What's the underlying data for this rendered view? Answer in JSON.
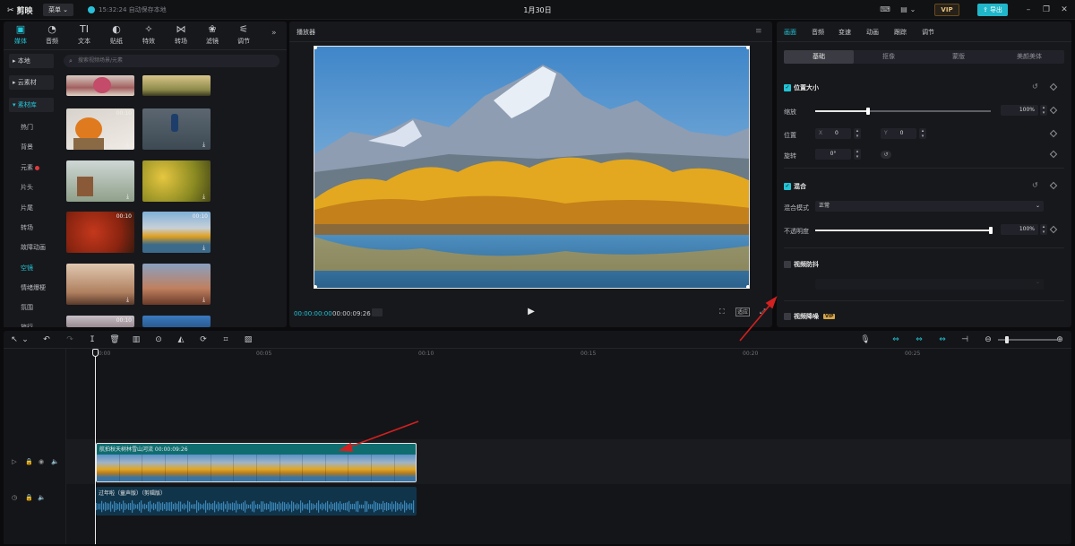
{
  "app": {
    "name": "剪映",
    "menu_label": "菜单",
    "save_status": "15:32:24 自动保存本地",
    "project_title": "1月30日",
    "vip_label": "VIP",
    "export_label": "导出"
  },
  "media_tabs": [
    {
      "label": "媒体",
      "icon": "media-icon"
    },
    {
      "label": "音频",
      "icon": "audio-icon"
    },
    {
      "label": "文本",
      "icon": "text-icon"
    },
    {
      "label": "贴纸",
      "icon": "sticker-icon"
    },
    {
      "label": "特效",
      "icon": "effects-icon"
    },
    {
      "label": "转场",
      "icon": "transition-icon"
    },
    {
      "label": "滤镜",
      "icon": "filter-icon"
    },
    {
      "label": "调节",
      "icon": "adjust-icon"
    }
  ],
  "left_categories": {
    "local": "本地",
    "cloud": "云素材",
    "library": "素材库",
    "subs": [
      "热门",
      "背景",
      "元素",
      "片头",
      "片尾",
      "转场",
      "故障动画",
      "空镜",
      "情绪爆梗",
      "氛围",
      "旅行"
    ]
  },
  "search_placeholder": "搜索视频场景/元素",
  "thumb_durations": [
    "00:10",
    "00:10",
    "00:10",
    "00:10"
  ],
  "player": {
    "title": "播放器",
    "time_current": "00:00:00:00",
    "time_total": "00:00:09:26",
    "ratio_label": "适应"
  },
  "right_tabs": [
    "画面",
    "音频",
    "变速",
    "动画",
    "跟踪",
    "调节"
  ],
  "right_subtabs": [
    "基础",
    "抠像",
    "蒙版",
    "美颜美体"
  ],
  "props": {
    "position_size": "位置大小",
    "scale_label": "缩放",
    "scale_value": "100%",
    "scale_fraction": 0.3,
    "position_label": "位置",
    "pos_x_label": "X",
    "pos_x": "0",
    "pos_y_label": "Y",
    "pos_y": "0",
    "rotate_label": "旋转",
    "rotate_value": "0°",
    "blend": "混合",
    "blend_mode_label": "混合模式",
    "blend_mode_value": "正常",
    "opacity_label": "不透明度",
    "opacity_value": "100%",
    "opacity_fraction": 1.0,
    "stabilize": "视频防抖",
    "denoise": "视频降噪",
    "denoise_vip": "VIP"
  },
  "timeline": {
    "ticks": [
      "00:00",
      "00:05",
      "00:10",
      "00:15",
      "00:20",
      "00:25"
    ],
    "clip_label": "航拍秋天树林雪山河流  00:00:09:26",
    "cover_label": "封面",
    "audio_label": "过年啦（童声版）（剪辑版）"
  },
  "colors": {
    "accent": "#22c4d6",
    "clip": "#0f6d70",
    "audio": "#10344a"
  }
}
